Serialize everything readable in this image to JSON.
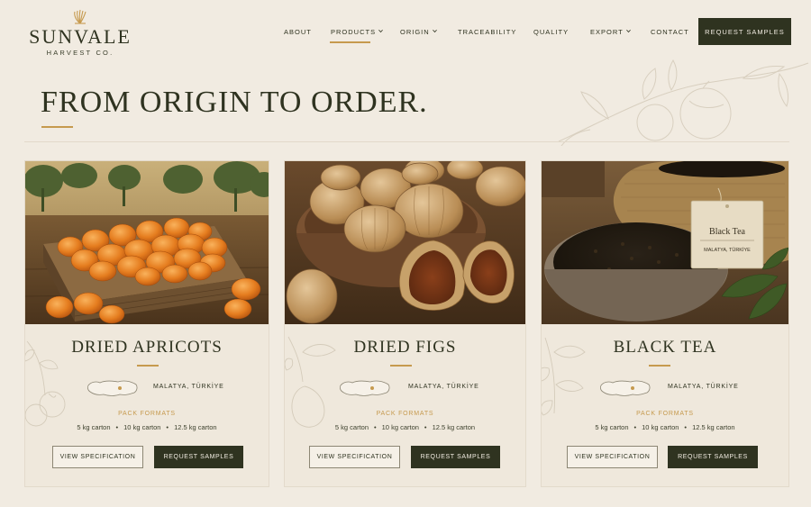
{
  "brand": {
    "name": "SUNVALE",
    "tagline": "HARVEST CO."
  },
  "nav": {
    "items": [
      {
        "label": "ABOUT"
      },
      {
        "label": "PRODUCTS",
        "active": true,
        "has_dropdown": true
      },
      {
        "label": "ORIGIN",
        "has_dropdown": true
      },
      {
        "label": "TRACEABILITY"
      },
      {
        "label": "QUALITY"
      },
      {
        "label": "EXPORT",
        "has_dropdown": true
      },
      {
        "label": "CONTACT"
      }
    ],
    "cta_label": "REQUEST SAMPLES"
  },
  "hero": {
    "title": "FROM ORIGIN TO ORDER."
  },
  "products": [
    {
      "title": "DRIED APRICOTS",
      "origin": "MALATYA, TÜRKİYE",
      "pack_label": "PACK FORMATS",
      "pack_formats": [
        "5 kg carton",
        "10 kg carton",
        "12.5 kg carton"
      ],
      "spec_button": "VIEW SPECIFICATION",
      "samples_button": "REQUEST SAMPLES",
      "image_icon": "apricot-crate-image"
    },
    {
      "title": "DRIED FIGS",
      "origin": "MALATYA, TÜRKİYE",
      "pack_label": "PACK FORMATS",
      "pack_formats": [
        "5 kg carton",
        "10 kg carton",
        "12.5 kg carton"
      ],
      "spec_button": "VIEW SPECIFICATION",
      "samples_button": "REQUEST SAMPLES",
      "image_icon": "figs-bowl-image"
    },
    {
      "title": "BLACK TEA",
      "origin": "MALATYA, TÜRKİYE",
      "pack_label": "PACK FORMATS",
      "pack_formats": [
        "5 kg carton",
        "10 kg carton",
        "12.5 kg carton"
      ],
      "spec_button": "VIEW SPECIFICATION",
      "samples_button": "REQUEST SAMPLES",
      "image_icon": "black-tea-bowl-image",
      "tag_label": "Black Tea",
      "tag_sub": "MALATYA, TÜRKİYE"
    }
  ],
  "colors": {
    "background": "#f1ebe1",
    "primary_dark": "#2f3320",
    "accent_gold": "#c69a4e",
    "card_background": "#efe8dc"
  }
}
